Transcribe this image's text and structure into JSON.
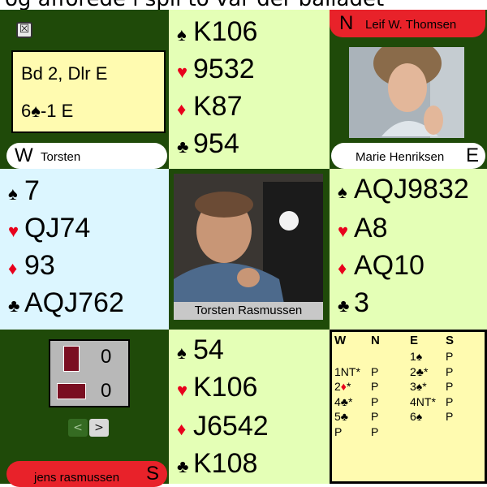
{
  "caption": "og afforede i spil to var der balladet",
  "board": {
    "line1": "Bd 2, Dlr E",
    "contract_level": "6",
    "contract_suit": "♠",
    "contract_result": "-1 E"
  },
  "icons": {
    "close": "☒"
  },
  "north": {
    "seat": "N",
    "name": "Leif W. Thomsen",
    "spades": "K106",
    "hearts": "9532",
    "diamonds": "K87",
    "clubs": "954"
  },
  "west": {
    "seat": "W",
    "name": "Torsten",
    "spades": "7",
    "hearts": "QJ74",
    "diamonds": "93",
    "clubs": "AQJ762"
  },
  "east": {
    "seat": "E",
    "name": "Marie Henriksen",
    "spades": "AQJ9832",
    "hearts": "A8",
    "diamonds": "AQ10",
    "clubs": "3"
  },
  "south": {
    "seat": "S",
    "name": "jens rasmussen",
    "spades": "54",
    "hearts": "K106",
    "diamonds": "J6542",
    "clubs": "K108"
  },
  "center_video": {
    "name": "Torsten Rasmussen"
  },
  "score": {
    "ns_tricks": "0",
    "ew_tricks": "0"
  },
  "nav": {
    "prev": "<",
    "next": ">"
  },
  "suits": {
    "spade": "♠",
    "heart": "♥",
    "diamond": "♦",
    "club": "♣"
  },
  "bidding": {
    "headers": [
      "W",
      "N",
      "E",
      "S"
    ],
    "rows": [
      [
        "",
        "",
        "1♠",
        "P"
      ],
      [
        "1NT*",
        "P",
        "2♣*",
        "P"
      ],
      [
        "2♦*",
        "P",
        "3♠*",
        "P"
      ],
      [
        "4♣*",
        "P",
        "4NT*",
        "P"
      ],
      [
        "5♣",
        "P",
        "6♠",
        "P"
      ],
      [
        "P",
        "P",
        "",
        ""
      ]
    ]
  },
  "colors": {
    "table_green": "#1f4a09",
    "ns_hand_bg": "#e4ffb6",
    "west_hand_bg": "#dcf6ff",
    "info_bg": "#fffbb0",
    "pill_red": "#e8222a",
    "suit_red": "#e8001c"
  }
}
